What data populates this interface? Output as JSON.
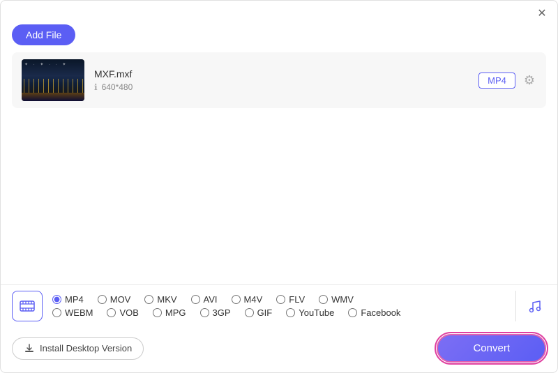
{
  "window": {
    "close_label": "✕"
  },
  "toolbar": {
    "add_file_label": "Add File"
  },
  "file": {
    "name": "MXF.mxf",
    "resolution": "640*480",
    "format": "MP4"
  },
  "format_options": {
    "row1": [
      {
        "id": "mp4",
        "label": "MP4",
        "checked": true
      },
      {
        "id": "mov",
        "label": "MOV",
        "checked": false
      },
      {
        "id": "mkv",
        "label": "MKV",
        "checked": false
      },
      {
        "id": "avi",
        "label": "AVI",
        "checked": false
      },
      {
        "id": "m4v",
        "label": "M4V",
        "checked": false
      },
      {
        "id": "flv",
        "label": "FLV",
        "checked": false
      },
      {
        "id": "wmv",
        "label": "WMV",
        "checked": false
      }
    ],
    "row2": [
      {
        "id": "webm",
        "label": "WEBM",
        "checked": false
      },
      {
        "id": "vob",
        "label": "VOB",
        "checked": false
      },
      {
        "id": "mpg",
        "label": "MPG",
        "checked": false
      },
      {
        "id": "3gp",
        "label": "3GP",
        "checked": false
      },
      {
        "id": "gif",
        "label": "GIF",
        "checked": false
      },
      {
        "id": "youtube",
        "label": "YouTube",
        "checked": false
      },
      {
        "id": "facebook",
        "label": "Facebook",
        "checked": false
      }
    ]
  },
  "bottom": {
    "install_label": "Install Desktop Version",
    "convert_label": "Convert"
  }
}
